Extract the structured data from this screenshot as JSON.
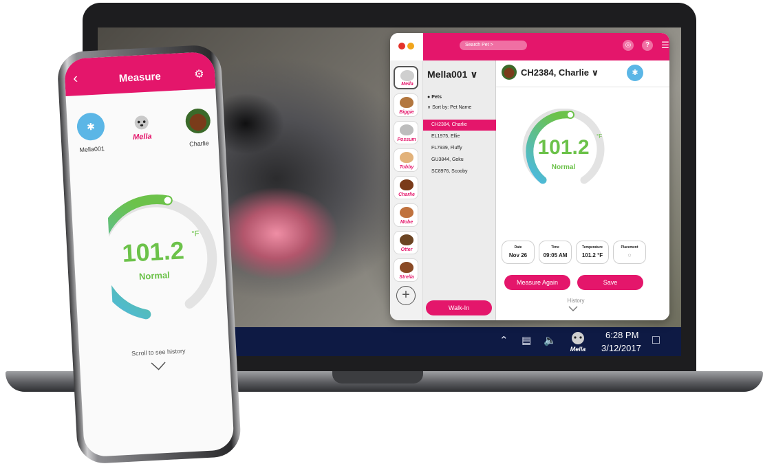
{
  "laptop": {
    "app": {
      "search_placeholder": "Search Pet >",
      "colors": {
        "brand_pink": "#e4166b",
        "gauge_green": "#6cc24a",
        "gauge_blue": "#4ab9e8"
      },
      "device_selector": "Mella001",
      "pets_label": "Pets",
      "sort_label": "Sort by: Pet Name",
      "pet_list": [
        "CH2384, Charlie",
        "EL1975, Ellie",
        "FL7939, Fluffy",
        "GU3844, Goku",
        "SC8976, Scooby"
      ],
      "selected_pet": "CH2384, Charlie",
      "rail_pets": [
        "Mella",
        "Biggie",
        "Possum",
        "Tobby",
        "Charlie",
        "Mobe",
        "Otter",
        "Strella"
      ],
      "walk_in_label": "Walk-In",
      "temperature": "101.2",
      "unit": "°F",
      "status": "Normal",
      "gauge_fraction": 0.62,
      "stats": [
        {
          "label": "Date",
          "value": "Nov 26"
        },
        {
          "label": "Time",
          "value": "09:05 AM"
        },
        {
          "label": "Temperature",
          "value": "101.2 °F"
        },
        {
          "label": "Placement",
          "value": ""
        }
      ],
      "measure_again_label": "Measure Again",
      "save_label": "Save",
      "history_label": "History"
    },
    "taskbar": {
      "time": "6:28 PM",
      "date": "3/12/2017",
      "mella_logo_text": "Mella"
    }
  },
  "phone": {
    "title": "Measure",
    "device_label": "Mella001",
    "logo_text": "Mella",
    "pet_label": "Charlie",
    "temperature": "101.2",
    "unit": "°F",
    "status": "Normal",
    "scroll_hint": "Scroll to see history"
  }
}
